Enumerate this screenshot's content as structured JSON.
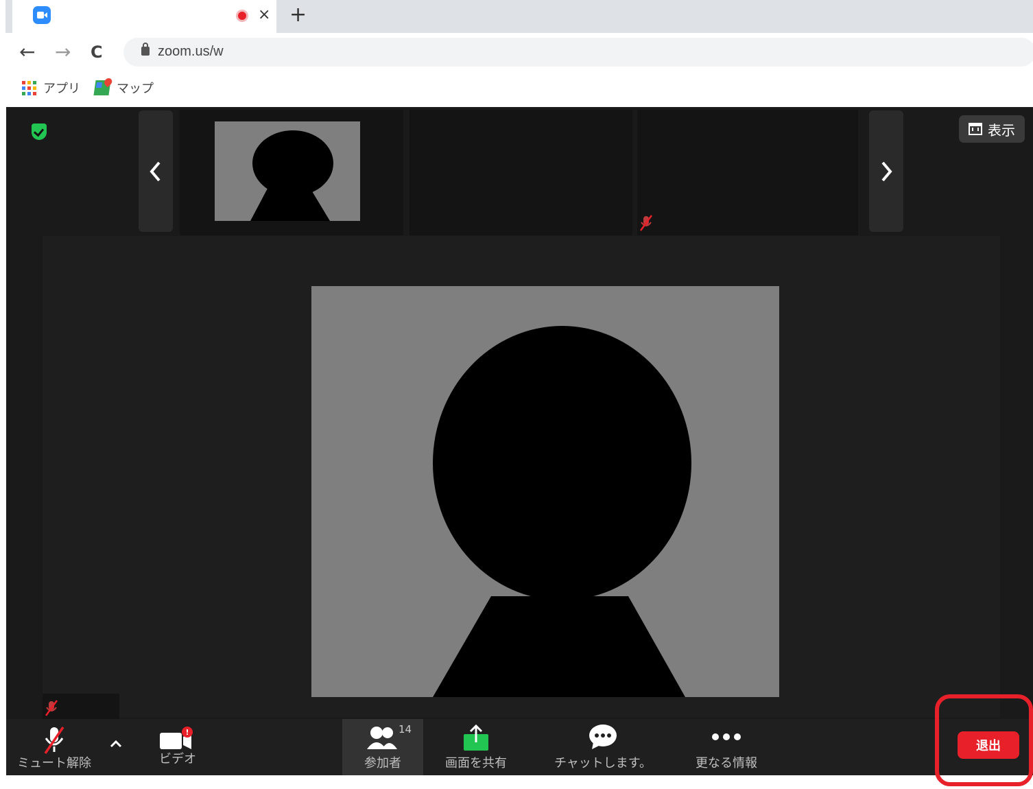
{
  "browser": {
    "tab": {
      "favicon": "zoom-icon",
      "recording_indicator": "record-dot-icon",
      "close": "×"
    },
    "new_tab": "+",
    "nav": {
      "back": "←",
      "forward": "→",
      "reload": "C"
    },
    "url": "zoom.us/w",
    "bookmarks": [
      {
        "icon": "apps-grid-icon",
        "label": "アプリ"
      },
      {
        "icon": "maps-icon",
        "label": "マップ"
      }
    ]
  },
  "meeting": {
    "view_button_label": "表示",
    "prev_arrow": "chevron-left-icon",
    "next_arrow": "chevron-right-icon"
  },
  "toolbar": {
    "mute": "ミュート解除",
    "video": "ビデオ",
    "participants": "参加者",
    "participants_count": "14",
    "share": "画面を共有",
    "chat": "チャットします。",
    "more": "更なる情報",
    "leave": "退出"
  },
  "colors": {
    "zoom_blue": "#2d8cff",
    "leave_red": "#e8202a",
    "share_green": "#23c552",
    "meeting_bg": "#1a1a1a"
  }
}
